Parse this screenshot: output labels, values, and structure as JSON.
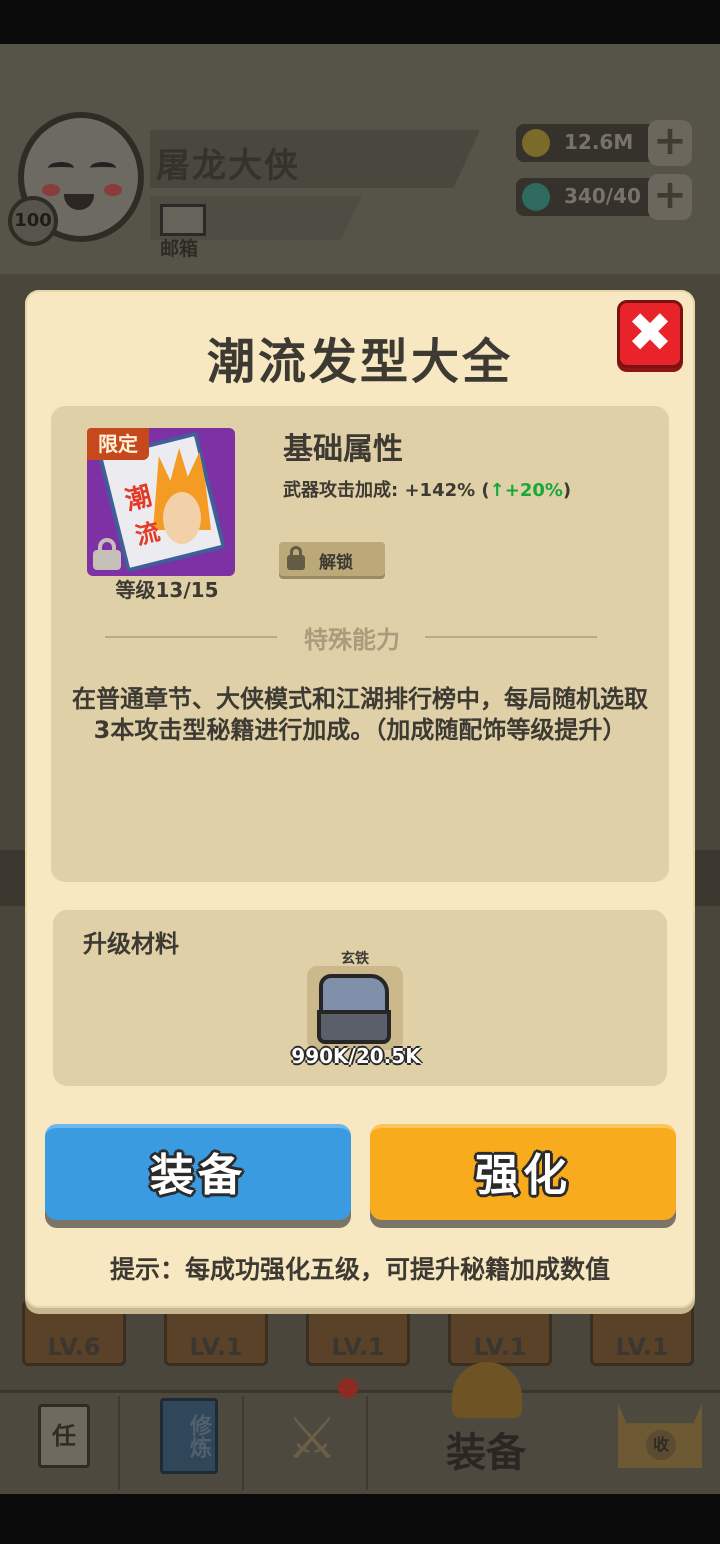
{
  "player": {
    "name": "屠龙大侠",
    "level": "100",
    "mail_label": "邮箱",
    "gold": "12.6M",
    "gems": "340/40"
  },
  "equip_slots": [
    {
      "level": "LV.6"
    },
    {
      "level": "LV.1"
    },
    {
      "level": "LV.1"
    },
    {
      "level": "LV.1"
    },
    {
      "level": "LV.1"
    }
  ],
  "bottom_nav": {
    "task_label": "任",
    "cultivate_label": "修炼",
    "equip_label": "装备",
    "shop_label": "收"
  },
  "modal": {
    "title": "潮流发型大全",
    "item": {
      "tag": "限定",
      "art_text_1": "潮",
      "art_text_2": "流",
      "level": "等级13/15"
    },
    "base_attr": {
      "heading": "基础属性",
      "label": "武器攻击加成: +142% (",
      "bonus_arrow": "↑",
      "bonus": "+20%",
      "close_paren": ")",
      "unlock_label": "解锁"
    },
    "special": {
      "heading": "特殊能力",
      "description": "在普通章节、大侠模式和江湖排行榜中，每局随机选取3本攻击型秘籍进行加成。（加成随配饰等级提升）"
    },
    "materials": {
      "heading": "升级材料",
      "item_name": "玄铁",
      "count": "990K/20.5K"
    },
    "buttons": {
      "equip": "装备",
      "upgrade": "强化"
    },
    "hint": "提示：每成功强化五级，可提升秘籍加成数值",
    "close_icon": "✖"
  },
  "colors": {
    "modal_bg": "#f8e8c1",
    "panel_bg": "#e0d0a8",
    "equip_button": "#3b9be0",
    "upgrade_button": "#f8ac1d",
    "close_button": "#e8232a",
    "bonus_green": "#18a83a",
    "limited_tag": "#c6491d"
  }
}
